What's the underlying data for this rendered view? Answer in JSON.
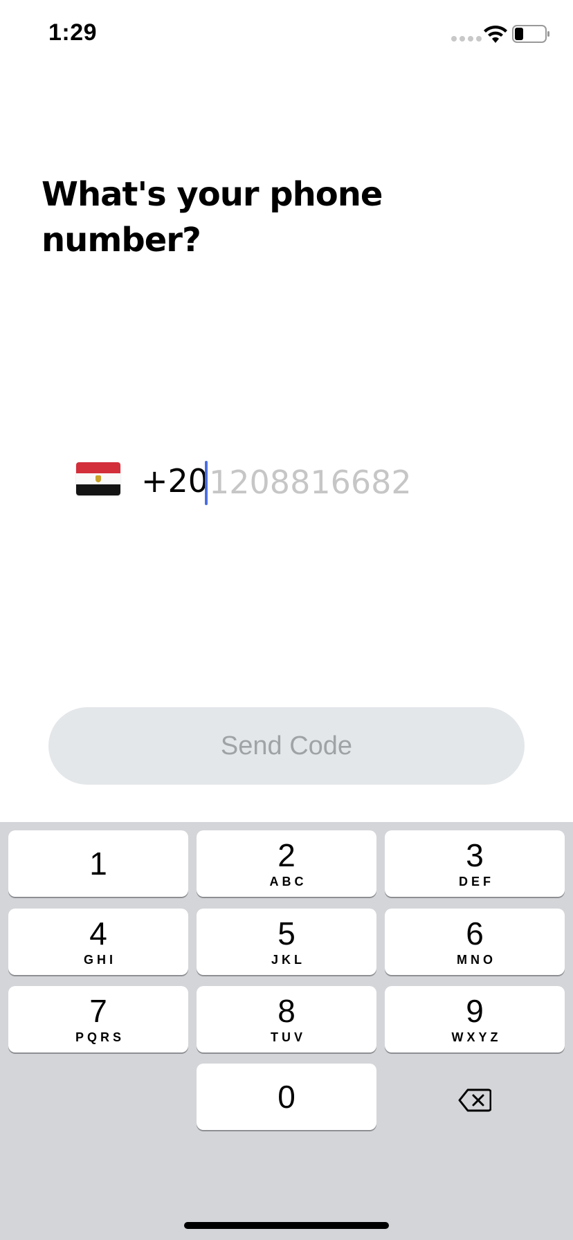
{
  "status_bar": {
    "time": "1:29"
  },
  "heading": {
    "line1": "What's your phone",
    "line2": "number?"
  },
  "phone": {
    "country_flag": "egypt-flag",
    "country_code": "+20",
    "value": "",
    "placeholder": "1208816682"
  },
  "send_button": {
    "label": "Send Code"
  },
  "keypad": {
    "keys": [
      {
        "digit": "1",
        "letters": ""
      },
      {
        "digit": "2",
        "letters": "ABC"
      },
      {
        "digit": "3",
        "letters": "DEF"
      },
      {
        "digit": "4",
        "letters": "GHI"
      },
      {
        "digit": "5",
        "letters": "JKL"
      },
      {
        "digit": "6",
        "letters": "MNO"
      },
      {
        "digit": "7",
        "letters": "PQRS"
      },
      {
        "digit": "8",
        "letters": "TUV"
      },
      {
        "digit": "9",
        "letters": "WXYZ"
      },
      {
        "digit": "0",
        "letters": ""
      }
    ],
    "delete_icon": "backspace-icon"
  },
  "colors": {
    "cursor": "#4a6ee0",
    "button_bg": "#e4e7ea",
    "button_text": "#9fa3a6",
    "keyboard_bg": "#d4d5d9"
  }
}
